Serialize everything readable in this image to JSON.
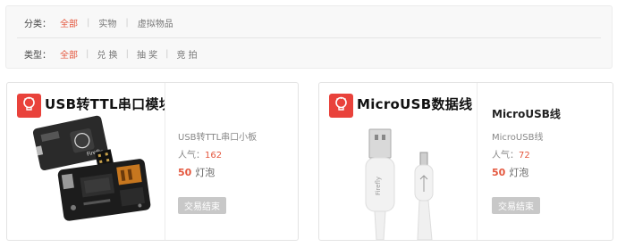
{
  "filters": {
    "category": {
      "label": "分类：",
      "options": [
        "全部",
        "实物",
        "虚拟物品"
      ],
      "selected": 0
    },
    "type": {
      "label": "类型：",
      "options": [
        "全部",
        "兑 换",
        "抽 奖",
        "竞 拍"
      ],
      "selected": 0
    }
  },
  "products": [
    {
      "image_title": "USB转TTL串口模块",
      "name": "",
      "subtitle": "USB转TTL串口小板",
      "popularity_label": "人气：",
      "popularity": "162",
      "price": "50",
      "price_unit": "灯泡",
      "button_label": "交易结束"
    },
    {
      "image_title": "MicroUSB数据线",
      "name": "MicroUSB线",
      "subtitle": "MicroUSB线",
      "popularity_label": "人气：",
      "popularity": "72",
      "price": "50",
      "price_unit": "灯泡",
      "button_label": "交易结束"
    }
  ],
  "brand": {
    "logo_text": "Firefly",
    "accent": "#e4573e",
    "logo_color": "#e9423b"
  }
}
